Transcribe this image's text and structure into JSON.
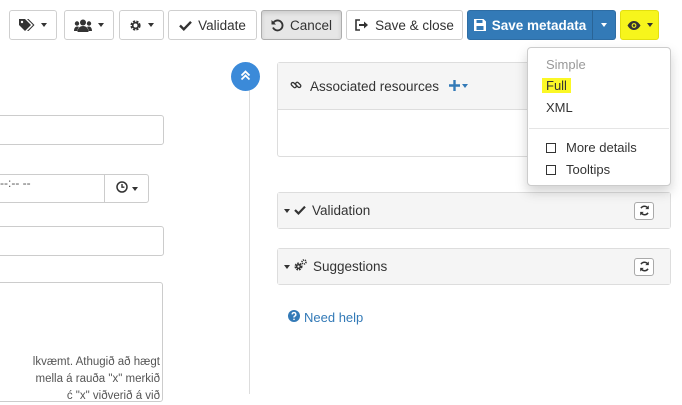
{
  "toolbar": {
    "validate_label": "Validate",
    "cancel_label": "Cancel",
    "save_close_label": "Save & close",
    "save_metadata_label": "Save metadata"
  },
  "left": {
    "date_placeholder": "--:-- --",
    "help_lines": [
      "lkvæmt. Athugið að hægt",
      "mella á rauða \"x\" merkið",
      "ć \"x\" viðverið á við"
    ]
  },
  "panels": {
    "associated_title": "Associated resources",
    "validation_title": "Validation",
    "suggestions_title": "Suggestions"
  },
  "need_help": "Need help",
  "view_menu": {
    "simple": "Simple",
    "full": "Full",
    "xml": "XML",
    "more_details": "More details",
    "tooltips": "Tooltips"
  },
  "colors": {
    "primary": "#337ab7",
    "highlight": "#f7f51c",
    "scroll_button": "#3b8ad9"
  }
}
